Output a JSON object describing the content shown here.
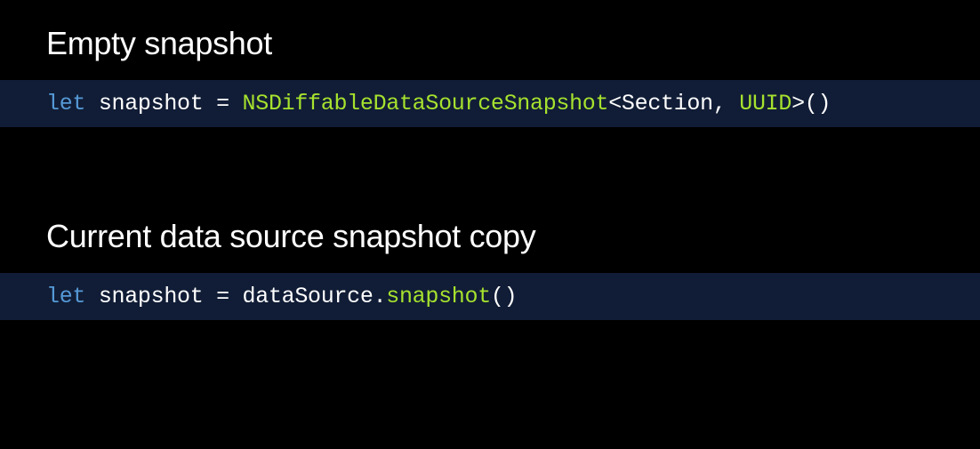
{
  "sections": [
    {
      "heading": "Empty snapshot",
      "code": {
        "keyword": "let",
        "space1": " ",
        "identifier": "snapshot",
        "space2": " ",
        "equals": "=",
        "space3": " ",
        "typename": "NSDiffableDataSourceSnapshot",
        "lt": "<",
        "generic1": "Section",
        "comma": ",",
        "space4": " ",
        "generic2": "UUID",
        "gt": ">",
        "paren_open": "(",
        "paren_close": ")"
      }
    },
    {
      "heading": "Current data source snapshot copy",
      "code": {
        "keyword": "let",
        "space1": " ",
        "identifier": "snapshot",
        "space2": " ",
        "equals": "=",
        "space3": " ",
        "object": "dataSource",
        "dot": ".",
        "method": "snapshot",
        "paren_open": "(",
        "paren_close": ")"
      }
    }
  ]
}
